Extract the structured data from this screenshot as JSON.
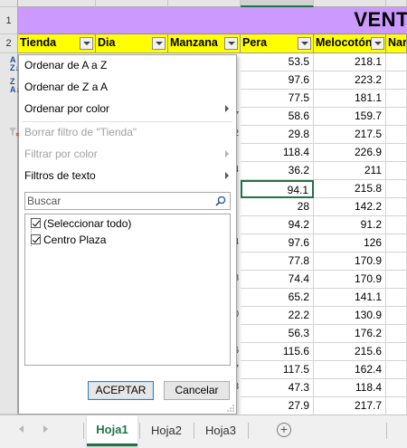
{
  "sheet": {
    "title": "VENT",
    "row_numbers": [
      "1",
      "2"
    ],
    "headers": [
      "Tienda",
      "Dia",
      "Manzana",
      "Pera",
      "Melocotón",
      "Nar"
    ],
    "pera_values": [
      "53.5",
      "97.6",
      "77.5",
      "58.6",
      "29.8",
      "118.4",
      "36.2",
      "94.1",
      "28",
      "94.2",
      "97.6",
      "77.8",
      "74.4",
      "65.2",
      "22.2",
      "56.3",
      "115.6",
      "117.5",
      "47.3",
      "27.9"
    ],
    "melocoton_values": [
      "218.1",
      "223.2",
      "181.1",
      "159.7",
      "217.5",
      "226.9",
      "211",
      "215.8",
      "142.2",
      "91.2",
      "126",
      "170.9",
      "170.9",
      "141.1",
      "130.9",
      "176.2",
      "215.6",
      "162.4",
      "118.4",
      "217.7"
    ],
    "manzana_edge_digits": [
      "",
      "",
      "",
      "7",
      "2",
      "",
      "4",
      "",
      "",
      "",
      "4",
      "",
      "3",
      "",
      "0",
      "",
      "6",
      "7",
      "3",
      ""
    ],
    "selected_value": "94.1"
  },
  "filter_menu": {
    "sort_az": "Ordenar de A a Z",
    "sort_za": "Ordenar de Z a A",
    "sort_by_color": "Ordenar por color",
    "clear_filter": "Borrar filtro de \"Tienda\"",
    "filter_by_color": "Filtrar por color",
    "text_filters": "Filtros de texto",
    "search_placeholder": "Buscar",
    "items": [
      {
        "label": "(Seleccionar todo)",
        "checked": true
      },
      {
        "label": "Centro Plaza",
        "checked": true
      }
    ],
    "ok_label": "ACEPTAR",
    "cancel_label": "Cancelar"
  },
  "tabs": [
    {
      "label": "Hoja1",
      "active": true
    },
    {
      "label": "Hoja2",
      "active": false
    },
    {
      "label": "Hoja3",
      "active": false
    }
  ],
  "add_sheet_label": "+",
  "colors": {
    "title_bg": "#cc99ff",
    "header_bg": "#ffff00",
    "accent": "#217346",
    "sort_icon": "#1f4e9e"
  }
}
